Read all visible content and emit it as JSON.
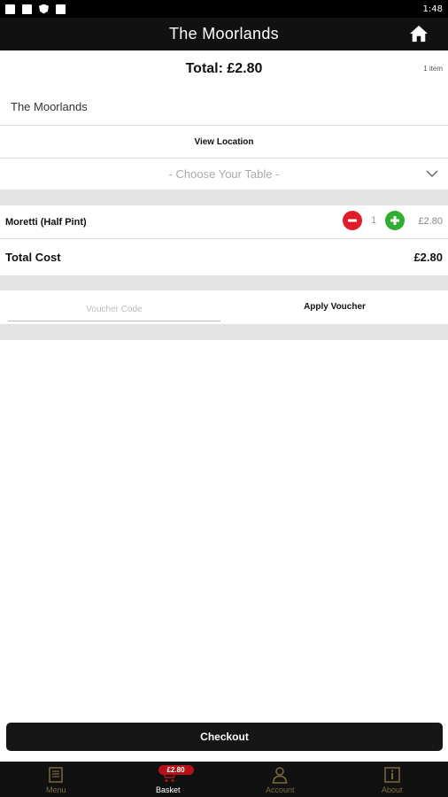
{
  "status_bar": {
    "time": "1:48"
  },
  "app_bar": {
    "title": "The Moorlands"
  },
  "basket": {
    "total_label": "Total: £2.80",
    "item_count": "1 item",
    "venue_name": "The Moorlands",
    "view_location": "View Location",
    "table_placeholder": "- Choose Your Table -"
  },
  "line_items": [
    {
      "name": "Moretti (Half Pint)",
      "quantity": "1",
      "price": "£2.80"
    }
  ],
  "total_cost": {
    "label": "Total Cost",
    "value": "£2.80"
  },
  "voucher": {
    "placeholder": "Voucher Code",
    "apply_label": "Apply Voucher"
  },
  "checkout": {
    "label": "Checkout"
  },
  "bottom_nav": {
    "items": [
      {
        "label": "Menu",
        "icon": "menu-book-icon"
      },
      {
        "label": "Basket",
        "icon": "cart-icon",
        "badge": "£2.80"
      },
      {
        "label": "Account",
        "icon": "user-icon"
      },
      {
        "label": "About",
        "icon": "info-icon"
      }
    ]
  },
  "colors": {
    "header_bg": "#111111",
    "minus": "#e01b2a",
    "plus": "#2fae2f",
    "badge": "#b3121b",
    "nav_inactive": "#7a6a3a"
  }
}
